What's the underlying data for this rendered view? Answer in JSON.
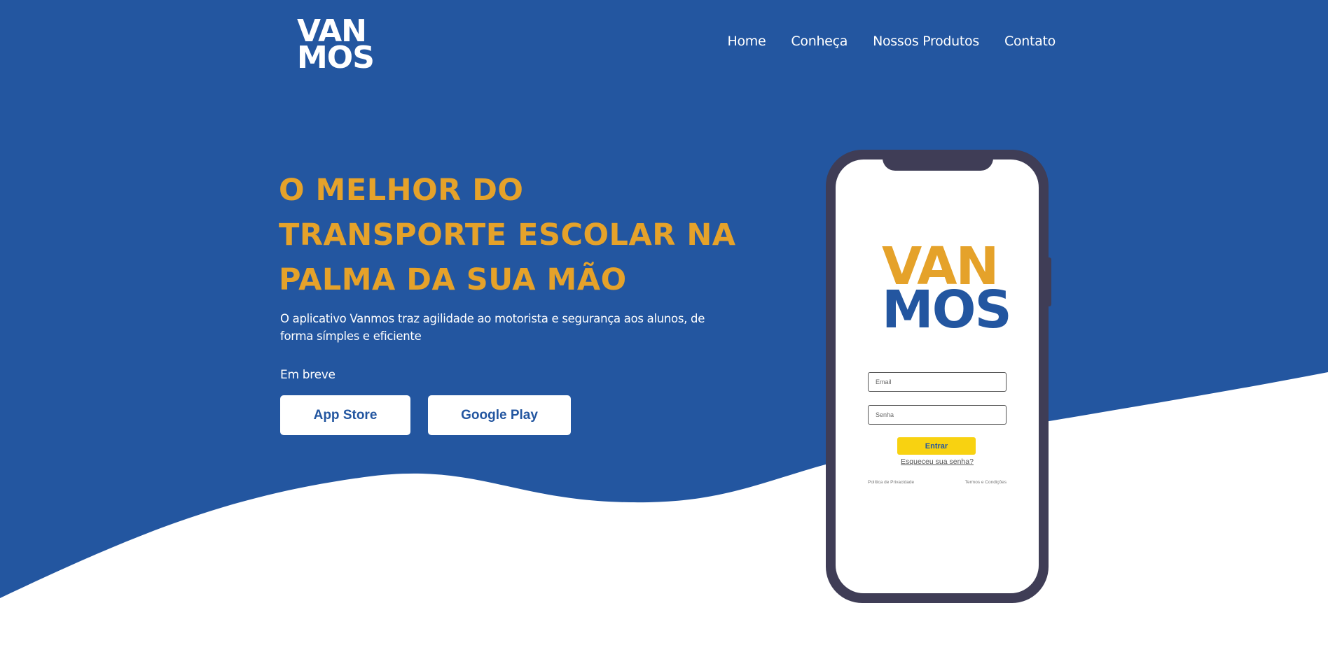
{
  "brand": {
    "logo_line1": "VAN",
    "logo_line2": "MOS"
  },
  "nav": {
    "items": [
      {
        "label": "Home"
      },
      {
        "label": "Conheça"
      },
      {
        "label": "Nossos Produtos"
      },
      {
        "label": "Contato"
      }
    ]
  },
  "hero": {
    "title_lines": [
      "O MELHOR DO",
      "TRANSPORTE ESCOLAR NA",
      "PALMA DA SUA MÃO"
    ],
    "subtitle": "O aplicativo Vanmos traz agilidade ao motorista e segurança aos alunos, de forma símples e eficiente",
    "soon_label": "Em breve",
    "buttons": {
      "app_store": "App Store",
      "google_play": "Google Play"
    }
  },
  "phone": {
    "logo_line1": "VAN",
    "logo_line2": "MOS",
    "email_placeholder": "Email",
    "password_placeholder": "Senha",
    "submit_label": "Entrar",
    "forgot_label": "Esqueceu sua senha?",
    "privacy_label": "Política de Privacidade",
    "terms_label": "Termos e Condições"
  },
  "colors": {
    "primary_blue": "#2356a0",
    "accent_orange": "#e5a22a",
    "button_yellow": "#f8d211",
    "phone_frame": "#3f3d56",
    "background_white": "#ffffff"
  }
}
